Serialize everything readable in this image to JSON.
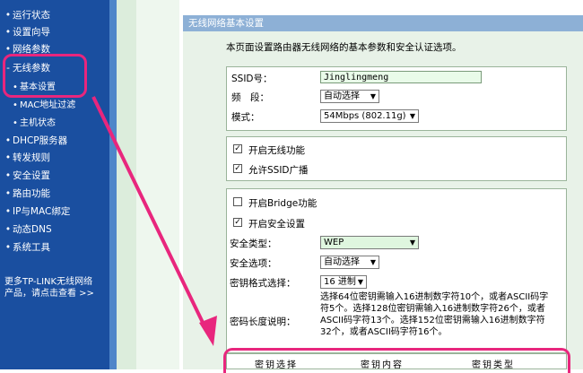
{
  "sidebar": {
    "items": [
      {
        "bullet": "•",
        "label": "运行状态"
      },
      {
        "bullet": "•",
        "label": "设置向导"
      },
      {
        "bullet": "•",
        "label": "网络参数"
      },
      {
        "bullet": "-",
        "label": "无线参数"
      },
      {
        "bullet": "•",
        "label": "基本设置"
      },
      {
        "bullet": "•",
        "label": "MAC地址过滤"
      },
      {
        "bullet": "•",
        "label": "主机状态"
      },
      {
        "bullet": "•",
        "label": "DHCP服务器"
      },
      {
        "bullet": "•",
        "label": "转发规则"
      },
      {
        "bullet": "•",
        "label": "安全设置"
      },
      {
        "bullet": "•",
        "label": "路由功能"
      },
      {
        "bullet": "•",
        "label": "IP与MAC绑定"
      },
      {
        "bullet": "•",
        "label": "动态DNS"
      },
      {
        "bullet": "•",
        "label": "系统工具"
      }
    ],
    "footer_line1": "更多TP-LINK无线网络",
    "footer_line2": "产品，请点击查看 >>"
  },
  "panel": {
    "title": "无线网络基本设置",
    "intro": "本页面设置路由器无线网络的基本参数和安全认证选项。"
  },
  "basic": {
    "ssid_label": "SSID号：",
    "ssid_value": "Jinglingmeng",
    "channel_label": "频　段：",
    "channel_value": "自动选择",
    "mode_label": "模式：",
    "mode_value": "54Mbps (802.11g)"
  },
  "toggles": {
    "wireless_label": "开启无线功能",
    "ssid_broadcast_label": "允许SSID广播"
  },
  "security": {
    "bridge_label": "开启Bridge功能",
    "security_enable_label": "开启安全设置",
    "type_label": "安全类型：",
    "type_value": "WEP",
    "option_label": "安全选项：",
    "option_value": "自动选择",
    "format_label": "密钥格式选择：",
    "format_value": "16 进制",
    "length_label": "密码长度说明：",
    "length_desc": "选择64位密钥需输入16进制数字符10个，或者ASCII码字符5个。选择128位密钥需输入16进制数字符26个，或者ASCII码字符13个。选择152位密钥需输入16进制数字符32个，或者ASCII码字符16个。"
  },
  "key_table": {
    "col1": "密钥选择",
    "col2": "密钥内容",
    "col3": "密钥类型"
  },
  "colors": {
    "sidebar": "#1a4fa0",
    "highlight": "#e8267d",
    "panel_title": "#8db0d6"
  }
}
